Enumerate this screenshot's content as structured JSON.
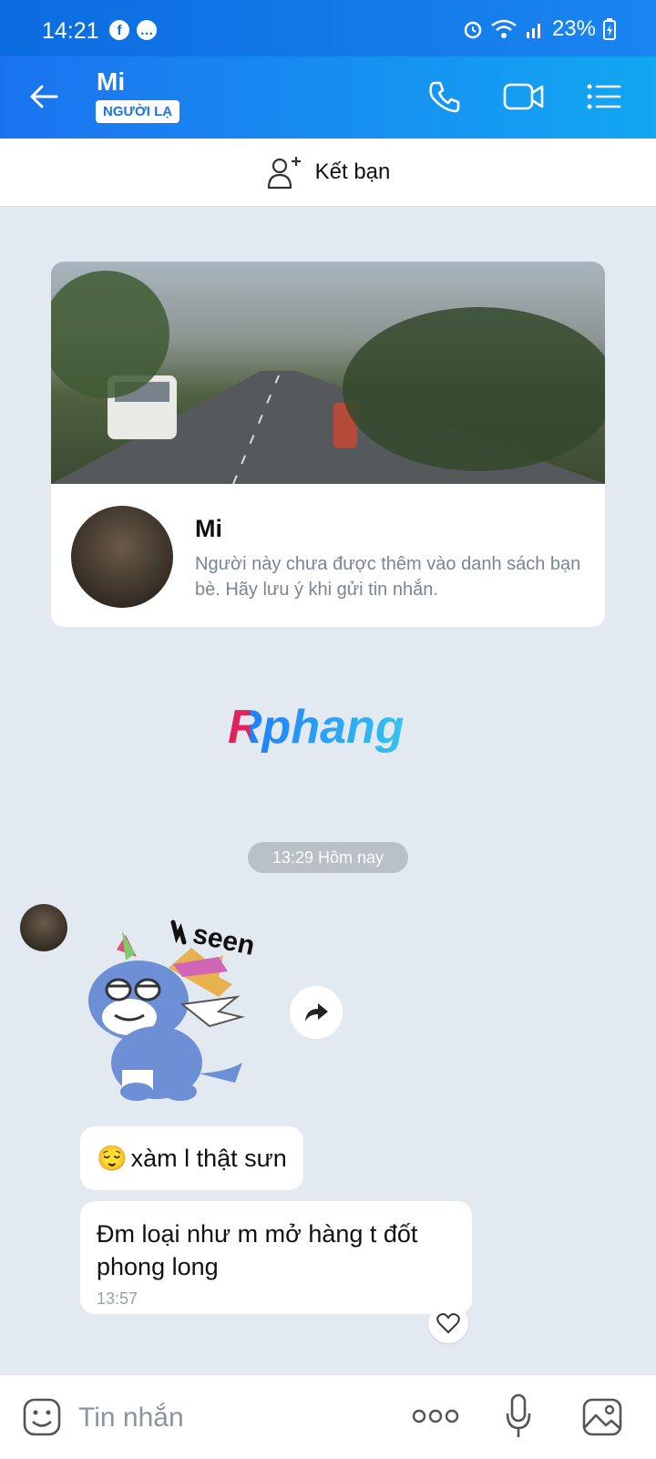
{
  "status_bar": {
    "time": "14:21",
    "battery": "23%",
    "left_icons": [
      "facebook-icon",
      "messenger-icon"
    ],
    "right_icons": [
      "alarm-icon",
      "wifi-icon",
      "signal-icon",
      "battery-charging-icon"
    ]
  },
  "header": {
    "name": "Mi",
    "badge": "NGƯỜI LẠ"
  },
  "add_friend": {
    "label": "Kết bạn"
  },
  "profile_card": {
    "name": "Mi",
    "description": "Người này chưa được thêm vào danh sách bạn bè. Hãy lưu ý khi gửi tin nhắn."
  },
  "watermark": {
    "text": "Rphang"
  },
  "chat": {
    "date_divider": "13:29 Hôm nay",
    "sticker_text": "seen",
    "messages": [
      {
        "emoji": "😌",
        "text": "xàm l thật sưn"
      },
      {
        "text": "Đm loại như m mở hàng t đốt phong long",
        "time": "13:57"
      }
    ]
  },
  "composer": {
    "placeholder": "Tin nhắn"
  },
  "colors": {
    "header_start": "#1b73f0",
    "header_end": "#12a7f2",
    "chat_bg": "#e2e9f1"
  }
}
